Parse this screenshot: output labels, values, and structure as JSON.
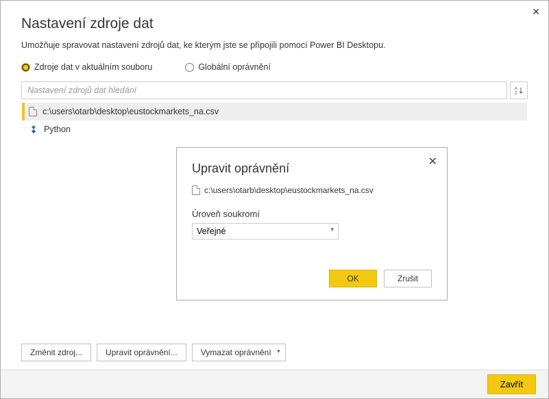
{
  "window": {
    "title": "Nastavení zdroje dat",
    "subtitle": "Umožňuje spravovat nastavení zdrojů dat, ke kterým jste se připojili pomocí Power BI Desktopu."
  },
  "radios": {
    "current_file": "Zdroje dat v aktuálním souboru",
    "global": "Globální oprávnění"
  },
  "search": {
    "placeholder": "Nastavení zdrojů dat hledání",
    "sort_label": "A↓Z"
  },
  "sources": [
    {
      "label": "c:\\users\\otarb\\desktop\\eustockmarkets_na.csv",
      "icon": "file-icon"
    },
    {
      "label": "Python",
      "icon": "python-icon"
    }
  ],
  "buttons": {
    "change_source": "Změnit zdroj...",
    "edit_permissions": "Upravit oprávnění...",
    "clear_permissions": "Vymazat oprávnění",
    "close": "Zavřít"
  },
  "modal": {
    "title": "Upravit oprávnění",
    "path": "c:\\users\\otarb\\desktop\\eustockmarkets_na.csv",
    "privacy_label": "Úroveň soukromí",
    "privacy_value": "Veřejné",
    "ok": "OK",
    "cancel": "Zrušit"
  }
}
